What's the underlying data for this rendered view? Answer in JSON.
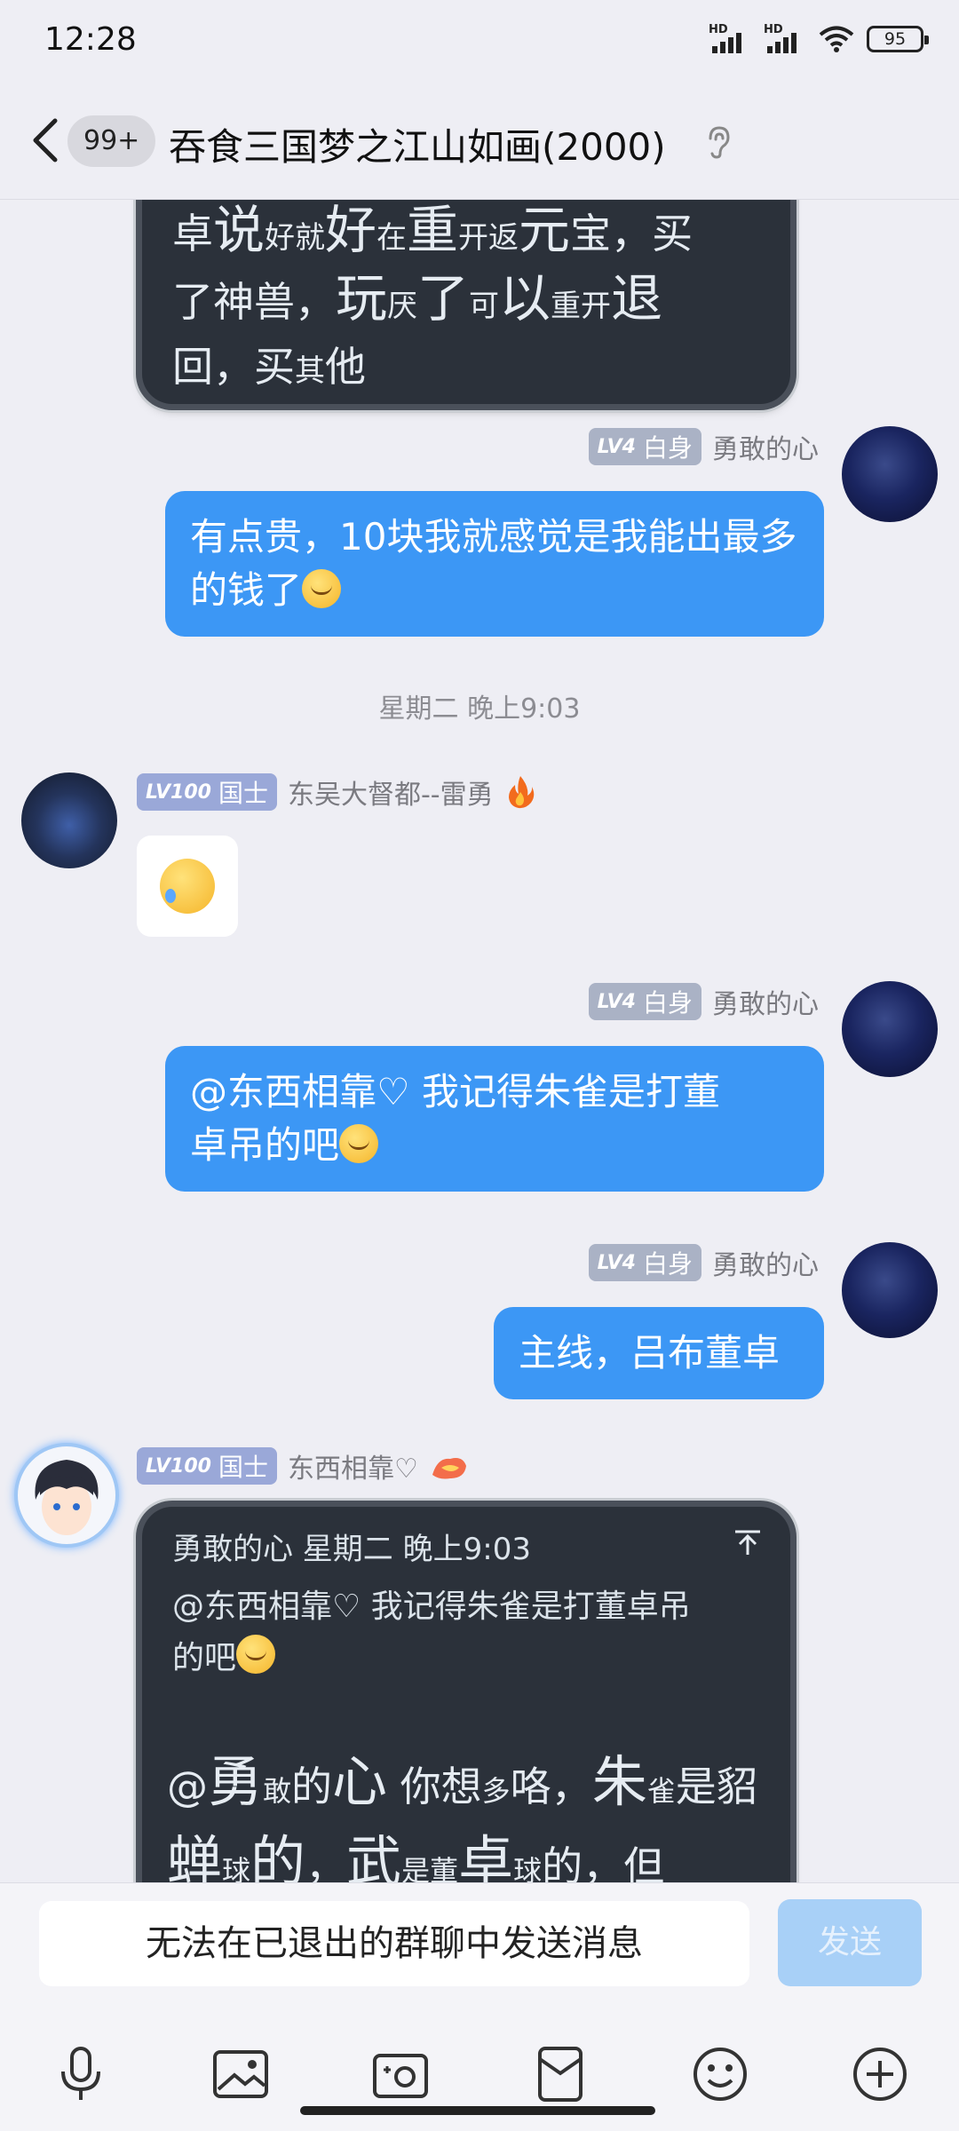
{
  "status_bar": {
    "time": "12:28",
    "battery": "95",
    "hd1": "HD",
    "hd2": "HD"
  },
  "header": {
    "unread_count": "99+",
    "title": "吞食三国梦之江山如画(2000)"
  },
  "messages": {
    "m0": {
      "line1_a": "卓",
      "line1_b": "说",
      "line1_c": "好就",
      "line1_d": "好",
      "line1_e": "在",
      "line1_f": "重",
      "line1_g": "开返",
      "line1_h": "元",
      "line1_i": "宝，买",
      "line2_a": "了神兽，",
      "line2_b": "玩",
      "line2_c": "厌",
      "line2_d": "了",
      "line2_e": "可",
      "line2_f": "以",
      "line2_g": "重开",
      "line2_h": "退",
      "line3_a": "回，买",
      "line3_b": "其",
      "line3_c": "他"
    },
    "m1": {
      "level": "LV4",
      "title": "白身",
      "name": "勇敢的心",
      "text": "有点贵，10块我就感觉是我能出最多的钱了"
    },
    "time_divider": "星期二 晚上9:03",
    "m2": {
      "level": "LV100",
      "title": "国士",
      "name": "东吴大督都--雷勇"
    },
    "m3": {
      "level": "LV4",
      "title": "白身",
      "name": "勇敢的心",
      "text1": "@东西相靠♡ 我记得朱雀是打董",
      "text2": "卓吊的吧"
    },
    "m4": {
      "level": "LV4",
      "title": "白身",
      "name": "勇敢的心",
      "text": "主线，吕布董卓"
    },
    "m5": {
      "level": "LV100",
      "title": "国士",
      "name": "东西相靠♡",
      "quote_head": "勇敢的心 星期二 晚上9:03",
      "quote_line1": "@东西相靠♡ 我记得朱雀是打董卓吊",
      "quote_line2": "的吧",
      "reply_a": "@",
      "reply_b": "勇",
      "reply_c": "敢",
      "reply_d": "的",
      "reply_e": "心",
      "reply_f": " 你想",
      "reply_g": "多",
      "reply_h": "咯，",
      "reply_i": "朱",
      "reply_j": "雀",
      "reply_k": "是貂",
      "reply2_a": "蝉",
      "reply2_b": "球",
      "reply2_c": "的",
      "reply2_d": "，",
      "reply2_e": "武",
      "reply2_f": "是董",
      "reply2_g": "卓",
      "reply2_h": "球",
      "reply2_i": "的，但"
    }
  },
  "input": {
    "disabled_text": "无法在已退出的群聊中发送消息",
    "send_label": "发送"
  },
  "icons": [
    "back-arrow-icon",
    "ear-icon",
    "fire-icon",
    "microphone-icon",
    "image-icon",
    "camera-icon",
    "red-packet-icon",
    "emoji-icon",
    "plus-icon",
    "quote-up-icon"
  ]
}
